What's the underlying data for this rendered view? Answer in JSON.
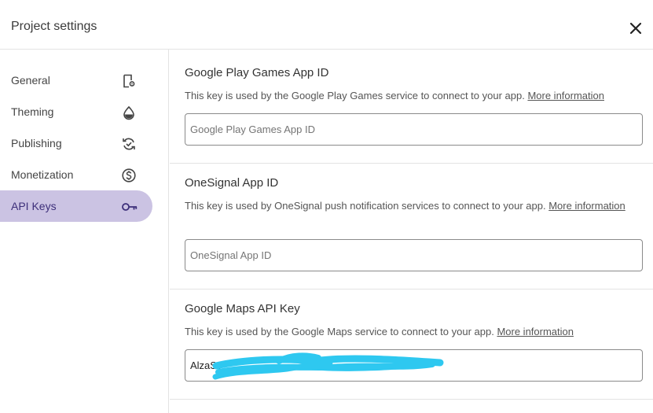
{
  "header": {
    "title": "Project settings",
    "close_icon": "close-icon"
  },
  "sidebar": {
    "items": [
      {
        "label": "General",
        "icon": "document-gear-icon",
        "active": false
      },
      {
        "label": "Theming",
        "icon": "droplet-icon",
        "active": false
      },
      {
        "label": "Publishing",
        "icon": "sync-check-icon",
        "active": false
      },
      {
        "label": "Monetization",
        "icon": "dollar-circle-icon",
        "active": false
      },
      {
        "label": "API Keys",
        "icon": "key-icon",
        "active": true
      }
    ],
    "active_color": "#cbc3e3"
  },
  "sections": [
    {
      "title": "Google Play Games App ID",
      "description": "This key is used by the Google Play Games service to connect to your app.",
      "link": "More information",
      "placeholder": "Google Play Games App ID",
      "value": ""
    },
    {
      "title": "OneSignal App ID",
      "description": "This key is used by OneSignal push notification services to connect to your app.",
      "link": "More information",
      "placeholder": "OneSignal App ID",
      "value": ""
    },
    {
      "title": "Google Maps API Key",
      "description": "This key is used by the Google Maps service to connect to your app.",
      "link": "More information",
      "placeholder": "",
      "value": "AlzaSy"
    }
  ],
  "redaction_color": "#2ec8f0"
}
